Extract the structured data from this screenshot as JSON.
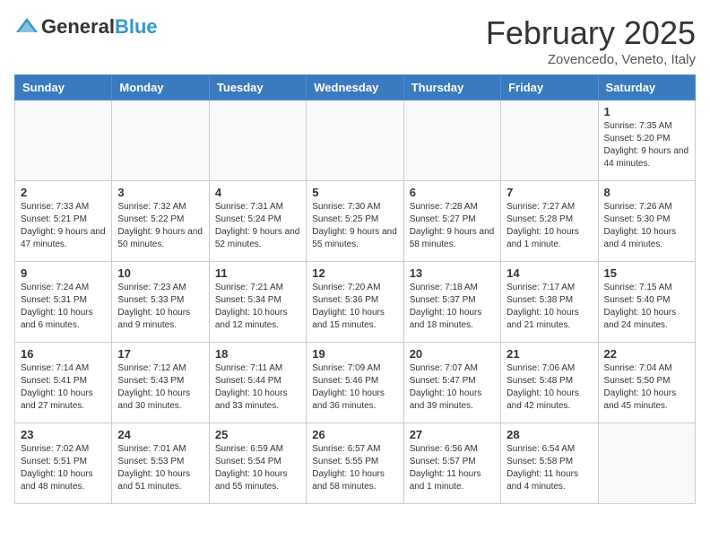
{
  "header": {
    "logo_general": "General",
    "logo_blue": "Blue",
    "month_title": "February 2025",
    "subtitle": "Zovencedo, Veneto, Italy"
  },
  "days_of_week": [
    "Sunday",
    "Monday",
    "Tuesday",
    "Wednesday",
    "Thursday",
    "Friday",
    "Saturday"
  ],
  "weeks": [
    [
      {
        "day": "",
        "info": ""
      },
      {
        "day": "",
        "info": ""
      },
      {
        "day": "",
        "info": ""
      },
      {
        "day": "",
        "info": ""
      },
      {
        "day": "",
        "info": ""
      },
      {
        "day": "",
        "info": ""
      },
      {
        "day": "1",
        "info": "Sunrise: 7:35 AM\nSunset: 5:20 PM\nDaylight: 9 hours and 44 minutes."
      }
    ],
    [
      {
        "day": "2",
        "info": "Sunrise: 7:33 AM\nSunset: 5:21 PM\nDaylight: 9 hours and 47 minutes."
      },
      {
        "day": "3",
        "info": "Sunrise: 7:32 AM\nSunset: 5:22 PM\nDaylight: 9 hours and 50 minutes."
      },
      {
        "day": "4",
        "info": "Sunrise: 7:31 AM\nSunset: 5:24 PM\nDaylight: 9 hours and 52 minutes."
      },
      {
        "day": "5",
        "info": "Sunrise: 7:30 AM\nSunset: 5:25 PM\nDaylight: 9 hours and 55 minutes."
      },
      {
        "day": "6",
        "info": "Sunrise: 7:28 AM\nSunset: 5:27 PM\nDaylight: 9 hours and 58 minutes."
      },
      {
        "day": "7",
        "info": "Sunrise: 7:27 AM\nSunset: 5:28 PM\nDaylight: 10 hours and 1 minute."
      },
      {
        "day": "8",
        "info": "Sunrise: 7:26 AM\nSunset: 5:30 PM\nDaylight: 10 hours and 4 minutes."
      }
    ],
    [
      {
        "day": "9",
        "info": "Sunrise: 7:24 AM\nSunset: 5:31 PM\nDaylight: 10 hours and 6 minutes."
      },
      {
        "day": "10",
        "info": "Sunrise: 7:23 AM\nSunset: 5:33 PM\nDaylight: 10 hours and 9 minutes."
      },
      {
        "day": "11",
        "info": "Sunrise: 7:21 AM\nSunset: 5:34 PM\nDaylight: 10 hours and 12 minutes."
      },
      {
        "day": "12",
        "info": "Sunrise: 7:20 AM\nSunset: 5:36 PM\nDaylight: 10 hours and 15 minutes."
      },
      {
        "day": "13",
        "info": "Sunrise: 7:18 AM\nSunset: 5:37 PM\nDaylight: 10 hours and 18 minutes."
      },
      {
        "day": "14",
        "info": "Sunrise: 7:17 AM\nSunset: 5:38 PM\nDaylight: 10 hours and 21 minutes."
      },
      {
        "day": "15",
        "info": "Sunrise: 7:15 AM\nSunset: 5:40 PM\nDaylight: 10 hours and 24 minutes."
      }
    ],
    [
      {
        "day": "16",
        "info": "Sunrise: 7:14 AM\nSunset: 5:41 PM\nDaylight: 10 hours and 27 minutes."
      },
      {
        "day": "17",
        "info": "Sunrise: 7:12 AM\nSunset: 5:43 PM\nDaylight: 10 hours and 30 minutes."
      },
      {
        "day": "18",
        "info": "Sunrise: 7:11 AM\nSunset: 5:44 PM\nDaylight: 10 hours and 33 minutes."
      },
      {
        "day": "19",
        "info": "Sunrise: 7:09 AM\nSunset: 5:46 PM\nDaylight: 10 hours and 36 minutes."
      },
      {
        "day": "20",
        "info": "Sunrise: 7:07 AM\nSunset: 5:47 PM\nDaylight: 10 hours and 39 minutes."
      },
      {
        "day": "21",
        "info": "Sunrise: 7:06 AM\nSunset: 5:48 PM\nDaylight: 10 hours and 42 minutes."
      },
      {
        "day": "22",
        "info": "Sunrise: 7:04 AM\nSunset: 5:50 PM\nDaylight: 10 hours and 45 minutes."
      }
    ],
    [
      {
        "day": "23",
        "info": "Sunrise: 7:02 AM\nSunset: 5:51 PM\nDaylight: 10 hours and 48 minutes."
      },
      {
        "day": "24",
        "info": "Sunrise: 7:01 AM\nSunset: 5:53 PM\nDaylight: 10 hours and 51 minutes."
      },
      {
        "day": "25",
        "info": "Sunrise: 6:59 AM\nSunset: 5:54 PM\nDaylight: 10 hours and 55 minutes."
      },
      {
        "day": "26",
        "info": "Sunrise: 6:57 AM\nSunset: 5:55 PM\nDaylight: 10 hours and 58 minutes."
      },
      {
        "day": "27",
        "info": "Sunrise: 6:56 AM\nSunset: 5:57 PM\nDaylight: 11 hours and 1 minute."
      },
      {
        "day": "28",
        "info": "Sunrise: 6:54 AM\nSunset: 5:58 PM\nDaylight: 11 hours and 4 minutes."
      },
      {
        "day": "",
        "info": ""
      }
    ]
  ]
}
